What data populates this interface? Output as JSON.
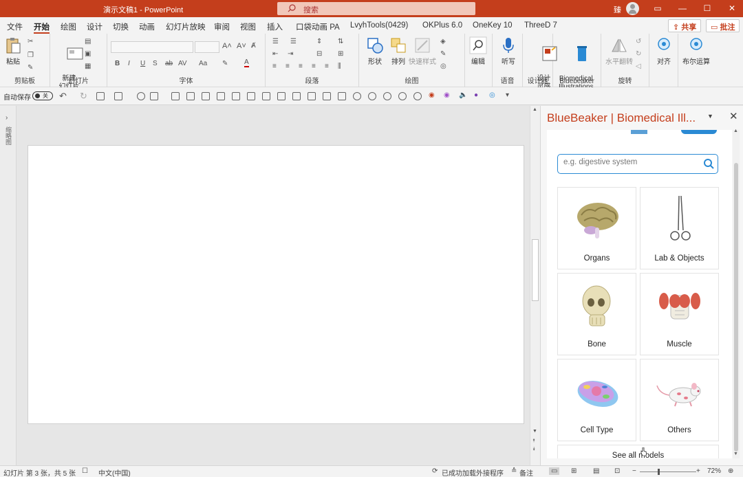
{
  "titlebar": {
    "doc_title": "演示文稿1  -  PowerPoint",
    "search_placeholder": "搜索",
    "user_name": "臻",
    "min": "—",
    "max": "☐",
    "close": "✕"
  },
  "tabs": [
    "文件",
    "开始",
    "绘图",
    "设计",
    "切换",
    "动画",
    "幻灯片放映",
    "审阅",
    "视图",
    "插入",
    "口袋动画 PA",
    "LvyhTools(0429)",
    "OKPlus 6.0",
    "OneKey 10",
    "ThreeD 7"
  ],
  "active_tab": "开始",
  "share_label": "共享",
  "comment_label": "批注",
  "ribbon": {
    "paste": "粘贴",
    "clipboard_group": "剪贴板",
    "new_slide": "新建\n幻灯片",
    "slides_group": "幻灯片",
    "font_group": "字体",
    "paragraph_group": "段落",
    "shapes": "形状",
    "arrange": "排列",
    "quick_styles": "快速样式",
    "drawing_group": "绘图",
    "edit": "编辑",
    "dictate": "听写",
    "voice_group": "语音",
    "design_ideas": "设计\n灵感",
    "designer_group": "设计器",
    "biomedical": "Biomedical\nIllustrations",
    "bluebeaker_group": "Bluebeaker",
    "flip_h": "水平翻转",
    "rotate_group": "旋转",
    "align": "对齐",
    "boolean": "布尔运算"
  },
  "qat": {
    "autosave": "自动保存",
    "toggle_state": "关"
  },
  "thumbstrip_label": "缩略图",
  "pane": {
    "title": "BlueBeaker | Biomedical Ill...",
    "search_placeholder": "e.g. digestive system",
    "categories": [
      {
        "label": "Organs",
        "icon": "brain-icon"
      },
      {
        "label": "Lab & Objects",
        "icon": "forceps-icon"
      },
      {
        "label": "Bone",
        "icon": "skull-icon"
      },
      {
        "label": "Muscle",
        "icon": "muscle-torso-icon"
      },
      {
        "label": "Cell Type",
        "icon": "cell-icon"
      },
      {
        "label": "Others",
        "icon": "mouse-icon"
      }
    ],
    "see_all": "See all models"
  },
  "status": {
    "slide_info": "幻灯片 第 3 张，共 5 张",
    "language": "中文(中国)",
    "addin_loaded": "已成功加载外接程序",
    "notes": "备注",
    "zoom": "72%"
  },
  "colors": {
    "accent": "#c43e1c",
    "bluebeaker_blue": "#2a8ad4"
  }
}
